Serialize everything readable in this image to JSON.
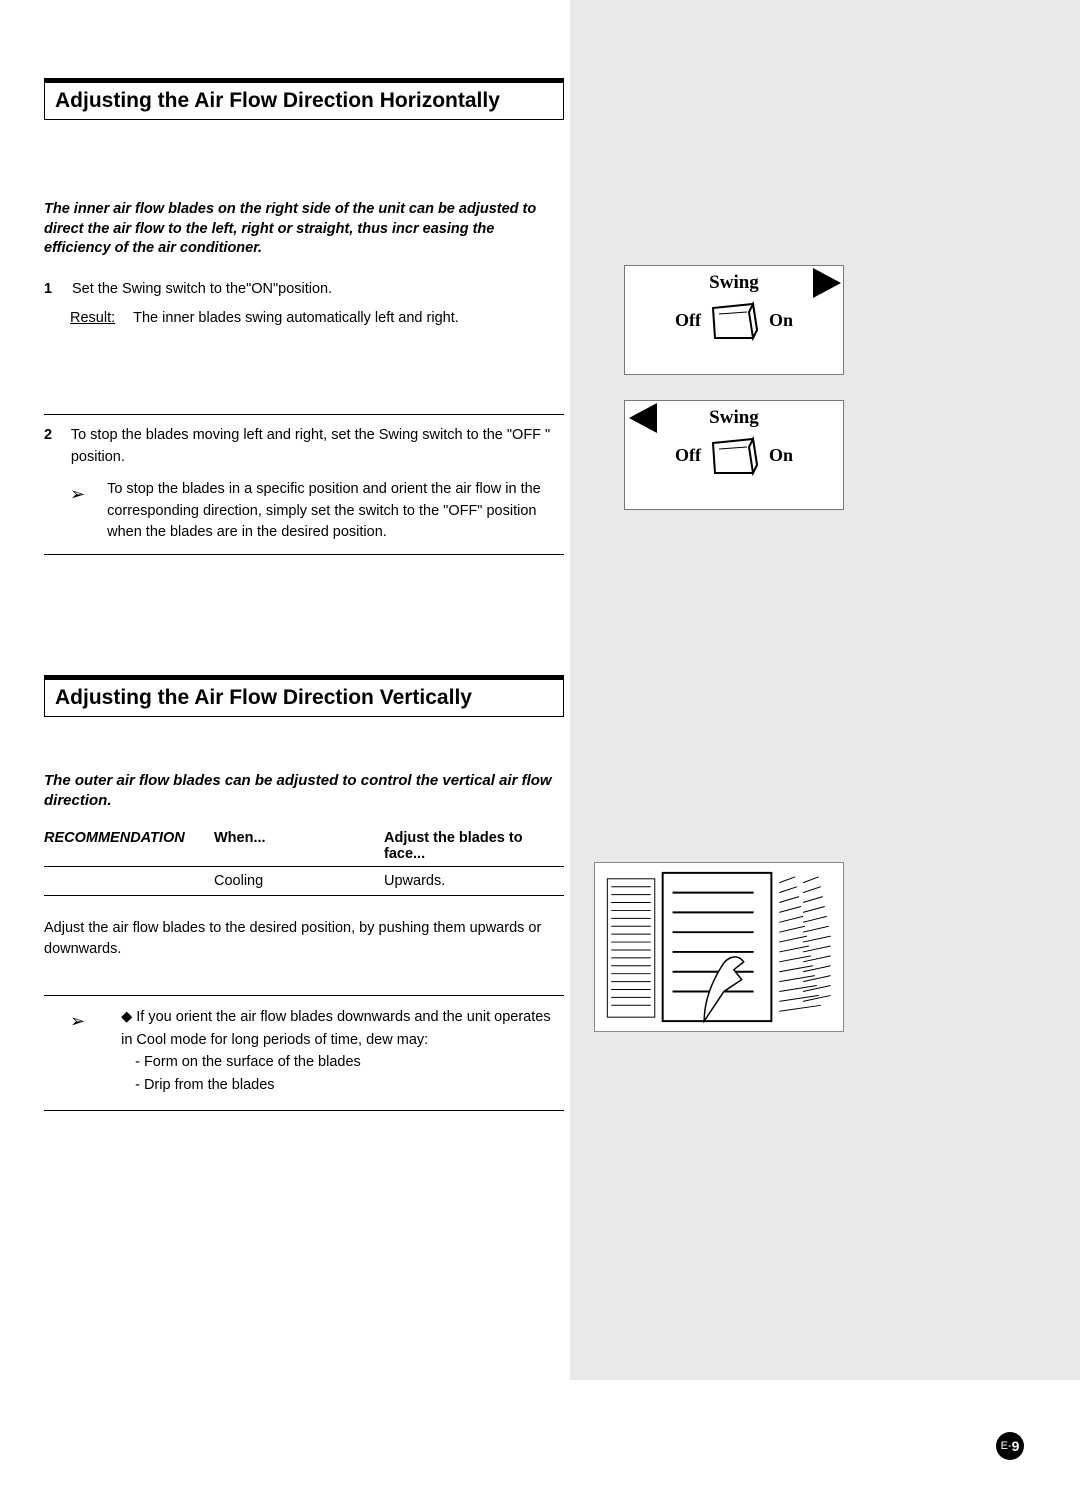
{
  "section1": {
    "title": "Adjusting the Air Flow Direction Horizontally",
    "intro": "The inner air flow blades on the right side of the unit can be adjusted to direct the air flow to the left, right or straight, thus incr easing the efficiency of the air conditioner.",
    "step1_num": "1",
    "step1_text": "Set the Swing switch to the\"ON\"position.",
    "result_label": "Result:",
    "result_text": "The inner blades swing automatically left and right.",
    "step2_num": "2",
    "step2_text": "To stop the blades moving left and right, set the Swing switch to the \"OFF \" position.",
    "note_arrow": "➢",
    "note_text": "To stop the blades in a specific position and orient the air flow in the corresponding direction, simply set the switch to the \"OFF\" position when the blades are in the desired position."
  },
  "swing": {
    "title": "Swing",
    "off": "Off",
    "on": "On"
  },
  "section2": {
    "title": "Adjusting the Air Flow Direction Vertically",
    "intro": "The outer air flow blades can be adjusted to control the vertical air flow direction.",
    "rec_label": "RECOMMENDATION",
    "col_when": "When...",
    "col_adjust": "Adjust the blades to face...",
    "row_when": "Cooling",
    "row_adjust": "Upwards.",
    "para": "Adjust the air flow blades to the desired position, by pushing them upwards or downwards.",
    "warn_arrow": "➢",
    "warn_bullet": "◆",
    "warn_lead": "If you orient the air flow blades downwards and the unit operates in Cool mode for long periods of time, dew may:",
    "warn_l1": "- Form on the surface of the blades",
    "warn_l2": "- Drip from the blades"
  },
  "pagenum": {
    "prefix": "E-",
    "num": "9"
  }
}
